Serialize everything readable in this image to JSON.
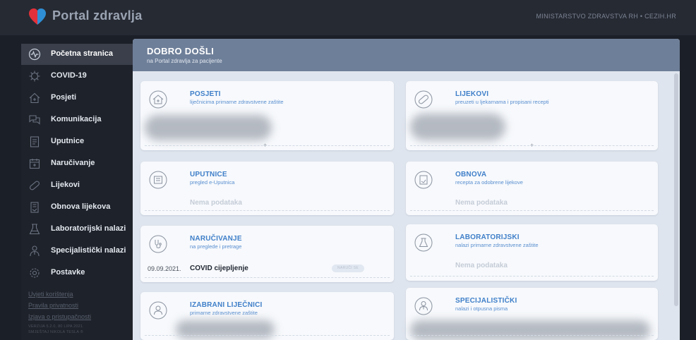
{
  "header": {
    "logo_text": "Portal zdravlja",
    "right_text": "MINISTARSTVO ZDRAVSTVA RH • CEZIH.HR"
  },
  "sidebar": {
    "items": [
      {
        "label": "Početna stranica",
        "icon": "activity-icon",
        "active": true
      },
      {
        "label": "COVID-19",
        "icon": "virus-icon"
      },
      {
        "label": "Posjeti",
        "icon": "house-icon"
      },
      {
        "label": "Komunikacija",
        "icon": "chat-icon"
      },
      {
        "label": "Uputnice",
        "icon": "document-icon"
      },
      {
        "label": "Naručivanje",
        "icon": "calendar-icon"
      },
      {
        "label": "Lijekovi",
        "icon": "pill-icon"
      },
      {
        "label": "Obnova lijekova",
        "icon": "prescription-icon"
      },
      {
        "label": "Laboratorijski nalazi",
        "icon": "flask-icon"
      },
      {
        "label": "Specijalistički nalazi",
        "icon": "doctor-icon"
      },
      {
        "label": "Postavke",
        "icon": "gear-icon"
      }
    ],
    "links": [
      "Uvjeti korištenja",
      "Pravila privatnosti",
      "Izjava o pristupačnosti"
    ],
    "version_lines": [
      "VERZIJA 5.2.0, 80 LIPA 2021.",
      "SMJEŠTAJ NIKOLA TESLA ®"
    ]
  },
  "welcome": {
    "title": "DOBRO DOŠLI",
    "subtitle": "na Portal zdravlja za pacijente"
  },
  "cards": {
    "posjeti": {
      "title": "POSJETI",
      "subtitle": "liječnicima primarne zdravstvene zaštite"
    },
    "lijekovi": {
      "title": "LIJEKOVI",
      "subtitle": "preuzeti u ljekarnama i propisani recepti"
    },
    "uputnice": {
      "title": "UPUTNICE",
      "subtitle": "pregled e-Uputnica",
      "empty": "Nema podataka"
    },
    "obnova": {
      "title": "OBNOVA",
      "subtitle": "recepta za odobrene lijekove",
      "empty": "Nema podataka"
    },
    "narucivanje": {
      "title": "NARUČIVANJE",
      "subtitle": "na preglede i pretrage",
      "date": "09.09.2021.",
      "name": "COVID cijepljenje",
      "badge": "NARUČI SE"
    },
    "laboratorijski": {
      "title": "LABORATORIJSKI",
      "subtitle": "nalazi primarne zdravstvene zaštite",
      "empty": "Nema podataka"
    },
    "izabrani": {
      "title": "IZABRANI LIJEČNICI",
      "subtitle": "primarne zdravstvene zaštite"
    },
    "specijalisticki": {
      "title": "SPECIJALISTIČKI",
      "subtitle": "nalazi i otpusna pisma"
    }
  },
  "colors": {
    "accent": "#3f7fc9",
    "banner": "#6e7f99",
    "logo_red": "#e2313a",
    "logo_blue": "#2f8fd6"
  }
}
